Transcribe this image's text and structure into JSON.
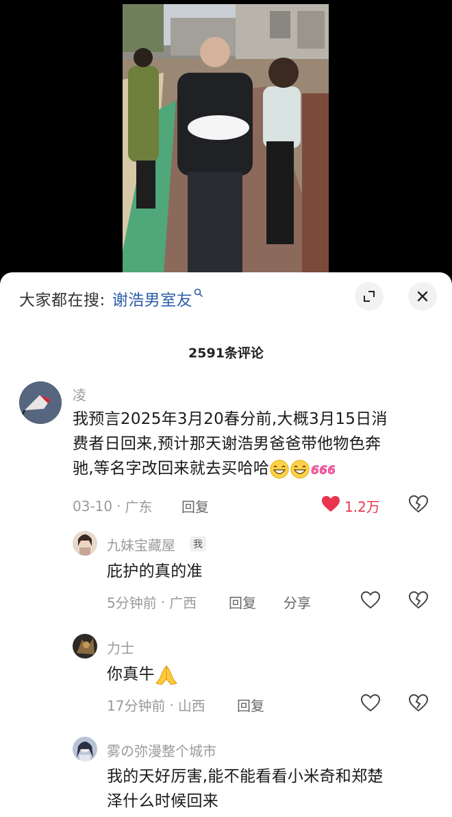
{
  "search": {
    "prefix": "大家都在搜:",
    "term": "谢浩男室友"
  },
  "comment_count_label": "2591条评论",
  "comments": [
    {
      "username": "凌",
      "lines": [
        "我预言2025年3月20春分前,大概3月15日消",
        "费者日回来,预计那天谢浩男爸爸带他物色奔",
        "驰,等名字改回来就去买哈哈"
      ],
      "date": "03-10",
      "location": "广东",
      "reply_label": "回复",
      "like_count": "1.2万",
      "liked": true
    },
    {
      "username": "九妹宝藏屋",
      "badge": "我",
      "text": "庇护的真的准",
      "time": "5分钟前",
      "location": "广西",
      "reply_label": "回复",
      "share_label": "分享"
    },
    {
      "username": "力士",
      "text": "你真牛",
      "time": "17分钟前",
      "location": "山西",
      "reply_label": "回复"
    },
    {
      "username": "雾の弥漫整个城市",
      "lines": [
        "我的天好厉害,能不能看看小米奇和郑楚",
        "泽什么时候回来"
      ]
    }
  ],
  "colors": {
    "like": "#e8344e",
    "link": "#2c5ea8"
  },
  "icons": [
    "search-icon",
    "expand-icon",
    "close-icon",
    "heart-icon",
    "broken-heart-icon",
    "grin-emoji",
    "666-emoji",
    "pray-emoji"
  ]
}
